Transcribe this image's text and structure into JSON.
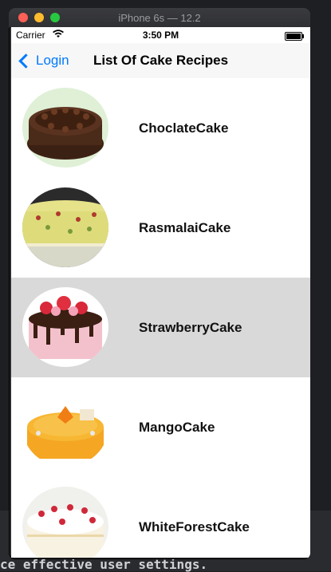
{
  "window": {
    "title": "iPhone 6s — 12.2"
  },
  "statusbar": {
    "carrier": "Carrier",
    "time": "3:50 PM",
    "battery_level": 1.0
  },
  "navbar": {
    "back_label": "Login",
    "title": "List Of Cake Recipes"
  },
  "recipes": [
    {
      "name": "ChoclateCake",
      "selected": false
    },
    {
      "name": "RasmalaiCake",
      "selected": false
    },
    {
      "name": "StrawberryCake",
      "selected": true
    },
    {
      "name": "MangoCake",
      "selected": false
    },
    {
      "name": "WhiteForestCake",
      "selected": false
    }
  ],
  "background": {
    "console_text": "ce effective user settings."
  },
  "colors": {
    "accent": "#007aff",
    "selected_row": "#d9d9d9"
  }
}
